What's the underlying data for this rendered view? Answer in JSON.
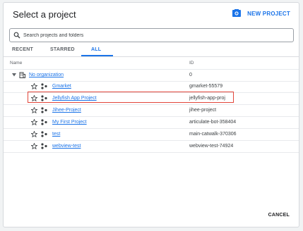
{
  "dialog": {
    "title": "Select a project",
    "new_project_label": "NEW PROJECT"
  },
  "search": {
    "placeholder": "Search projects and folders",
    "value": ""
  },
  "tabs": {
    "items": [
      {
        "label": "RECENT"
      },
      {
        "label": "STARRED"
      },
      {
        "label": "ALL"
      }
    ],
    "active": "ALL"
  },
  "table": {
    "headers": {
      "name": "Name",
      "id": "ID"
    },
    "org": {
      "name": "No organization",
      "id": "0"
    },
    "projects": [
      {
        "name": "Gmarket",
        "id": "gmarket-55579"
      },
      {
        "name": "Jellyfish App Project",
        "id": "jellyfish-app-proj"
      },
      {
        "name": "Jihee-Project",
        "id": "jihee-project"
      },
      {
        "name": "My First Project",
        "id": "articulate-bot-358404"
      },
      {
        "name": "test",
        "id": "main-catwalk-370306"
      },
      {
        "name": "webview-test",
        "id": "webview-test-74924"
      }
    ]
  },
  "footer": {
    "cancel_label": "CANCEL"
  },
  "colors": {
    "accent": "#1a73e8",
    "highlight": "#e2463a"
  },
  "icons": [
    "new-project-icon",
    "search-icon",
    "caret-down-icon",
    "organization-icon",
    "star-icon",
    "project-icon"
  ]
}
